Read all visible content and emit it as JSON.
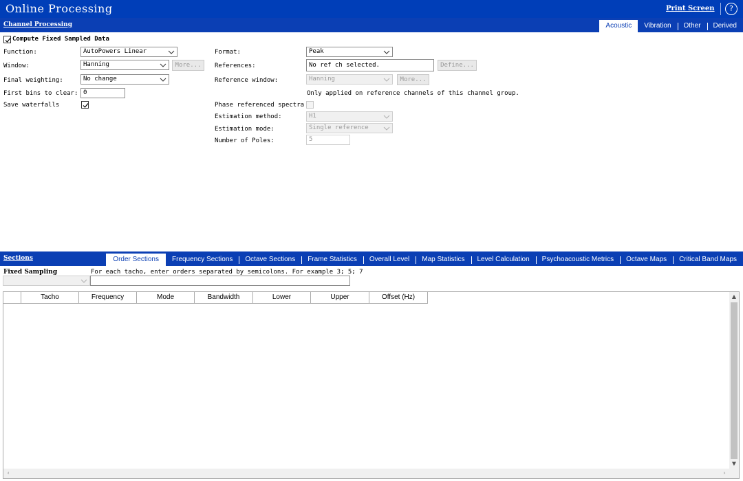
{
  "app": {
    "title": "Online Processing",
    "print_screen": "Print Screen",
    "help": "?"
  },
  "channel_processing": {
    "title": "Channel Processing",
    "tabs": [
      {
        "label": "Acoustic",
        "active": true
      },
      {
        "label": "Vibration",
        "active": false
      },
      {
        "label": "Other",
        "active": false
      },
      {
        "label": "Derived",
        "active": false
      }
    ],
    "compute_fixed": {
      "label": "Compute Fixed Sampled Data",
      "checked": true
    },
    "function": {
      "label": "Function:",
      "value": "AutoPowers Linear"
    },
    "window": {
      "label": "Window:",
      "value": "Hanning",
      "more": "More..."
    },
    "final_weighting": {
      "label": "Final weighting:",
      "value": "No change"
    },
    "first_bins": {
      "label": "First bins to clear:",
      "value": "0"
    },
    "save_waterfalls": {
      "label": "Save waterfalls",
      "checked": true
    },
    "format": {
      "label": "Format:",
      "value": "Peak"
    },
    "references": {
      "label": "References:",
      "value": "No ref ch selected.",
      "define": "Define..."
    },
    "reference_window": {
      "label": "Reference window:",
      "value": "Hanning",
      "more": "More...",
      "note": "Only applied on reference channels of this channel group."
    },
    "phase_referenced": {
      "label": "Phase referenced spectra",
      "checked": false
    },
    "estimation_method": {
      "label": "Estimation method:",
      "value": "H1"
    },
    "estimation_mode": {
      "label": "Estimation mode:",
      "value": "Single reference"
    },
    "number_of_poles": {
      "label": "Number of Poles:",
      "value": "5"
    }
  },
  "sections": {
    "title": "Sections",
    "tabs": [
      {
        "label": "Order Sections",
        "active": true
      },
      {
        "label": "Frequency Sections",
        "active": false
      },
      {
        "label": "Octave Sections",
        "active": false
      },
      {
        "label": "Frame Statistics",
        "active": false
      },
      {
        "label": "Overall Level",
        "active": false
      },
      {
        "label": "Map Statistics",
        "active": false
      },
      {
        "label": "Level Calculation",
        "active": false
      },
      {
        "label": "Psychoacoustic Metrics",
        "active": false
      },
      {
        "label": "Octave Maps",
        "active": false
      },
      {
        "label": "Critical Band Maps",
        "active": false
      }
    ],
    "fixed_sampling": {
      "label": "Fixed Sampling",
      "value": ""
    },
    "hint": "For each tacho, enter orders separated by semicolons. For example 3; 5; 7",
    "orders_input": "",
    "table": {
      "columns": [
        "",
        "Tacho",
        "Frequency",
        "Mode",
        "Bandwidth",
        "Lower",
        "Upper",
        "Offset (Hz)"
      ],
      "rows": []
    }
  },
  "colors": {
    "header_blue": "#003eb8",
    "bar_blue": "#0b3fb4",
    "disabled_gray": "#9a9a9a"
  }
}
